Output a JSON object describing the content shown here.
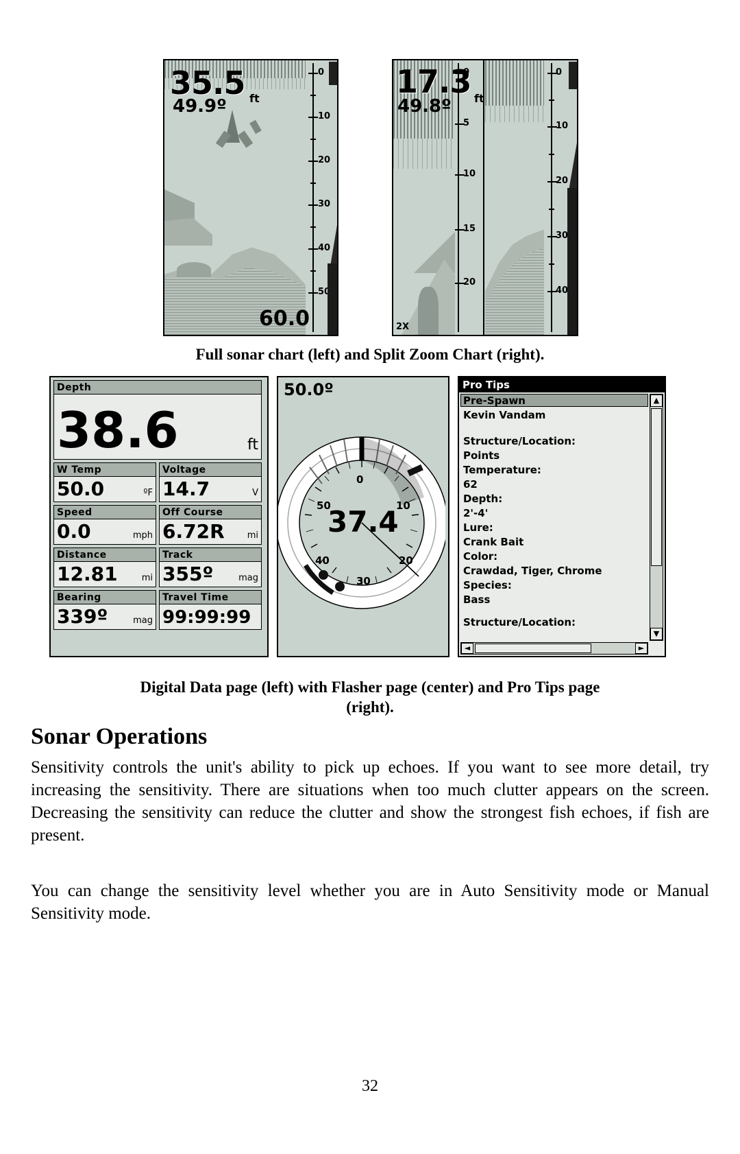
{
  "page": {
    "number": "32",
    "heading": "Sonar Operations",
    "paragraphs": [
      "Sensitivity controls the unit's ability to pick up echoes. If you want to see more detail, try increasing the sensitivity. There are situations when too much clutter appears on the screen. Decreasing the sensitivity can reduce the clutter and show the strongest fish echoes, if fish are present.",
      "You can change the sensitivity level whether you are in Auto Sensitivity mode or Manual Sensitivity mode."
    ],
    "captions": {
      "top": "Full sonar chart (left) and Split Zoom Chart (right).",
      "mid_line1": "Digital Data page (left) with Flasher page (center) and Pro Tips page",
      "mid_line2": "(right)."
    }
  },
  "sonar_full": {
    "depth": "35.5",
    "depth_unit": "ft",
    "temperature": "49.9º",
    "bottom_label": "60.0",
    "scale_labels": [
      "0",
      "10",
      "20",
      "30",
      "40",
      "50"
    ]
  },
  "sonar_split": {
    "depth": "17.3",
    "depth_unit": "ft",
    "temperature": "49.8º",
    "zoom_label": "2X",
    "zoom_scale_labels": [
      "0",
      "5",
      "10",
      "15",
      "20"
    ],
    "full_scale_labels": [
      "0",
      "10",
      "20",
      "30",
      "40"
    ]
  },
  "digital_data": {
    "cells": [
      {
        "title": "Depth",
        "value": "38.6",
        "unit": "ft"
      },
      {
        "title": "W Temp",
        "value": "50.0",
        "unit": "ºF"
      },
      {
        "title": "Voltage",
        "value": "14.7",
        "unit": "V"
      },
      {
        "title": "Speed",
        "value": "0.0",
        "unit": "mph"
      },
      {
        "title": "Off Course",
        "value": "6.72R",
        "unit": "mi"
      },
      {
        "title": "Distance",
        "value": "12.81",
        "unit": "mi"
      },
      {
        "title": "Track",
        "value": "355º",
        "unit": "mag"
      },
      {
        "title": "Bearing",
        "value": "339º",
        "unit": "mag"
      },
      {
        "title": "Travel Time",
        "value": "99:99:99",
        "unit": ""
      }
    ]
  },
  "flasher": {
    "range": "50.0º",
    "center_value": "37.4",
    "dial_labels": [
      "0",
      "10",
      "20",
      "30",
      "40",
      "50"
    ]
  },
  "pro_tips": {
    "title": "Pro Tips",
    "selected": "Pre-Spawn",
    "author": "Kevin Vandam",
    "lines": [
      "Structure/Location:",
      "Points",
      "Temperature:",
      "62",
      "Depth:",
      "2'-4'",
      "Lure:",
      "Crank Bait",
      "Color:",
      "Crawdad, Tiger, Chrome",
      "Species:",
      "Bass"
    ],
    "next_heading": "Structure/Location:",
    "scroll_up_icon": "▲",
    "scroll_down_icon": "▼",
    "scroll_left_icon": "◄",
    "scroll_right_icon": "►"
  }
}
